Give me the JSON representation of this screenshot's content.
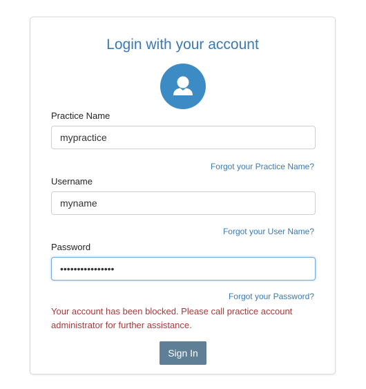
{
  "login": {
    "title": "Login with your account",
    "avatar_icon": "user-icon",
    "practice_label": "Practice Name",
    "practice_value": "mypractice",
    "forgot_practice": "Forgot your Practice Name?",
    "username_label": "Username",
    "username_value": "myname",
    "forgot_username": "Forgot your User Name?",
    "password_label": "Password",
    "password_value": "••••••••••••••••",
    "forgot_password": "Forgot your Password?",
    "error_message": "Your account has been blocked. Please call practice account administrator for further assistance.",
    "signin_label": "Sign In"
  },
  "colors": {
    "accent": "#3a79b4",
    "avatar": "#3d8bc4",
    "error": "#a33a3a",
    "button": "#5f7f96"
  }
}
